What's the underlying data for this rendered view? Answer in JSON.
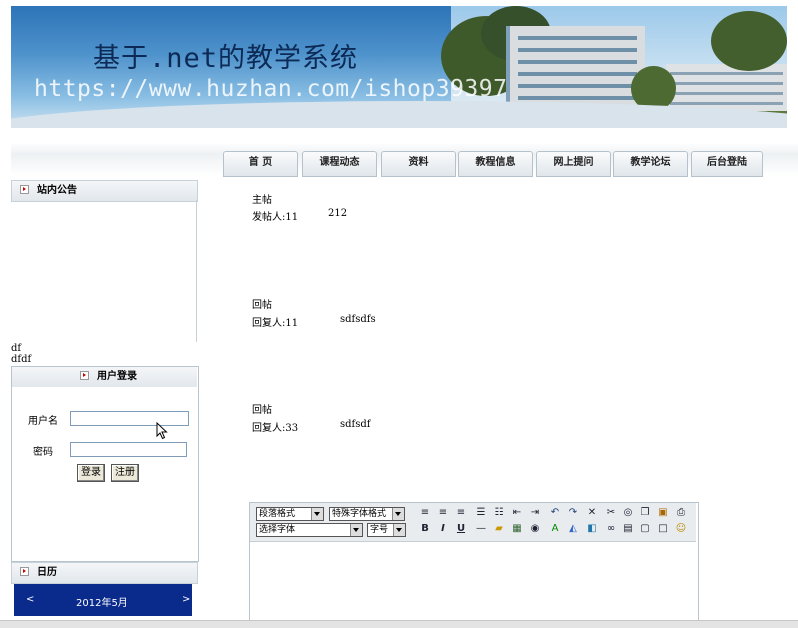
{
  "banner": {
    "title": "基于.net的教学系统",
    "watermark": "https://www.huzhan.com/ishop39397"
  },
  "nav": [
    {
      "label": "首  页"
    },
    {
      "label": "课程动态"
    },
    {
      "label": "资料"
    },
    {
      "label": "教程信息"
    },
    {
      "label": "网上提问"
    },
    {
      "label": "教学论坛"
    },
    {
      "label": "后台登陆"
    }
  ],
  "notice": {
    "header": "站内公告",
    "lines": [
      "df",
      "dfdf"
    ]
  },
  "login": {
    "header": "用户登录",
    "username_label": "用户名",
    "password_label": "密码",
    "username_value": "",
    "password_value": "",
    "login_button": "登录",
    "register_button": "注册"
  },
  "calendar": {
    "header": "日历",
    "prev": "<",
    "month": "2012年5月",
    "next": ">"
  },
  "posts": [
    {
      "type": "主帖",
      "author_label": "发帖人:11",
      "content": "212"
    },
    {
      "type": "回帖",
      "author_label": "回复人:11",
      "content": "sdfsdfs"
    },
    {
      "type": "回帖",
      "author_label": "回复人:33",
      "content": "sdfsdf"
    }
  ],
  "editor": {
    "paragraph_format": "段落格式",
    "special_format": "特殊字体格式",
    "font_select": "选择字体",
    "font_size": "字号",
    "icons": [
      "align-left-icon",
      "align-center-icon",
      "align-right-icon",
      "ordered-list-icon",
      "unordered-list-icon",
      "outdent-icon",
      "indent-icon",
      "undo-icon",
      "redo-icon",
      "remove-format-icon",
      "cut-icon",
      "find-icon",
      "copy-icon",
      "paste-icon",
      "print-icon",
      "bold-icon",
      "italic-icon",
      "underline-icon",
      "horizontal-rule-icon",
      "folder-icon",
      "image-icon",
      "media-icon",
      "text-color-icon",
      "background-color-icon",
      "insert-file-icon",
      "link-icon",
      "table-icon",
      "layer-icon",
      "special-char-icon",
      "smiley-icon"
    ]
  }
}
